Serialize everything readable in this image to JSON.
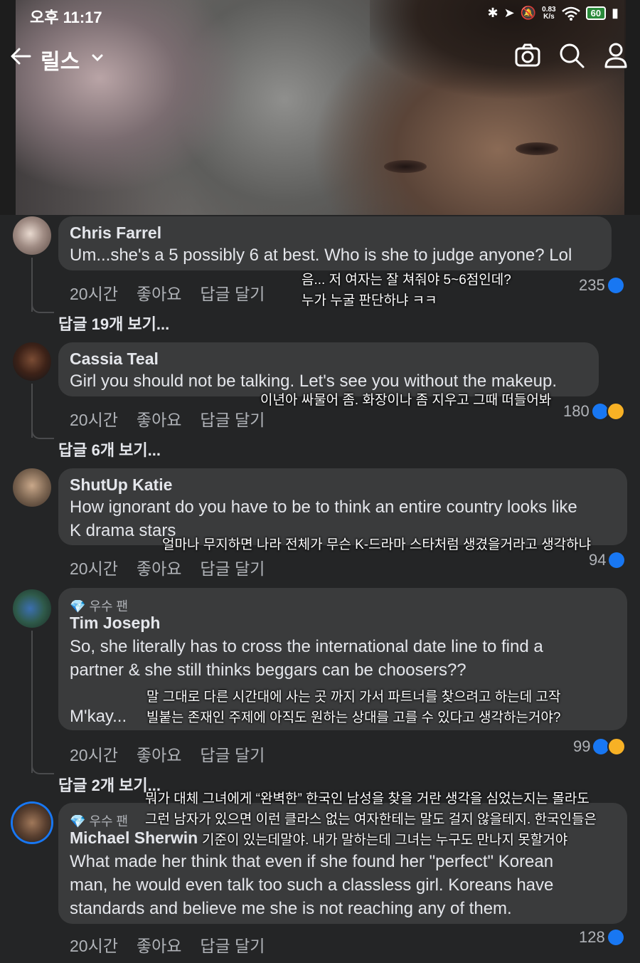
{
  "status_bar": {
    "time": "오후 11:17",
    "net_speed_value": "0.83",
    "net_speed_unit": "K/s",
    "battery": "60"
  },
  "header": {
    "title": "릴스",
    "icons": [
      "back-arrow-icon",
      "chevron-down-icon",
      "camera-icon",
      "search-icon",
      "profile-icon"
    ]
  },
  "comments": [
    {
      "name": "Chris Farrel",
      "text": "Um...she's a 5 possibly 6 at best. Who is she to judge anyone? Lol",
      "time": "20시간",
      "like_label": "좋아요",
      "reply_label": "답글 달기",
      "count": "235",
      "view_replies": "답글 19개 보기...",
      "overlay": [
        "음... 저 여자는 잘 쳐줘야 5~6점인데?",
        "누가 누굴 판단하냐 ㅋㅋ"
      ]
    },
    {
      "name": "Cassia Teal",
      "text": "Girl you should not be talking. Let's see you without the makeup.",
      "time": "20시간",
      "like_label": "좋아요",
      "reply_label": "답글 달기",
      "count": "180",
      "view_replies": "답글 6개 보기...",
      "overlay": [
        "이년아 싸물어 좀. 화장이나 좀 지우고 그때 떠들어봐"
      ]
    },
    {
      "name": "ShutUp Katie",
      "text_lines": [
        "How ignorant do you have to be to think an entire country looks like",
        "K drama stars"
      ],
      "time": "20시간",
      "like_label": "좋아요",
      "reply_label": "답글 달기",
      "count": "94",
      "overlay": [
        "얼마나 무지하면 나라 전체가 무슨 K-드라마 스타처럼 생겼을거라고 생각하냐"
      ]
    },
    {
      "badge": "우수 팬",
      "name": "Tim Joseph",
      "text_lines": [
        "So, she literally has to cross the international date line to find a",
        "partner & she still thinks beggars can be choosers??"
      ],
      "text_tail": "M'kay...",
      "time": "20시간",
      "like_label": "좋아요",
      "reply_label": "답글 달기",
      "count": "99",
      "view_replies": "답글 2개 보기...",
      "overlay": [
        "말 그대로 다른 시간대에 사는 곳 까지 가서 파트너를 찾으려고 하는데 고작",
        "빌붙는 존재인 주제에 아직도 원하는 상대를 고를 수 있다고 생각하는거야?"
      ]
    },
    {
      "badge": "우수 팬",
      "name": "Michael Sherwin",
      "text_lines": [
        "What made her think that even if she found her \"perfect\" Korean",
        "man, he would even talk too such a classless girl. Koreans have",
        "standards and believe me she is not reaching any of them."
      ],
      "time": "20시간",
      "like_label": "좋아요",
      "reply_label": "답글 달기",
      "count": "128",
      "overlay": [
        "뭐가 대체 그녀에게 “완벽한” 한국인 남성을 찾을 거란 생각을 심었는지는 몰라도",
        "그런 남자가 있으면 이런 클라스 없는 여자한테는 말도 걸지 않을테지. 한국인들은",
        "기준이 있는데말야. 내가 말하는데 그녀는 누구도 만나지 못할거야"
      ]
    }
  ],
  "colors": {
    "background": "#242526",
    "bubble": "#3a3b3c",
    "like_blue": "#1877f2",
    "haha_yellow": "#f7b125",
    "meta_gray": "#b0b3b8"
  }
}
